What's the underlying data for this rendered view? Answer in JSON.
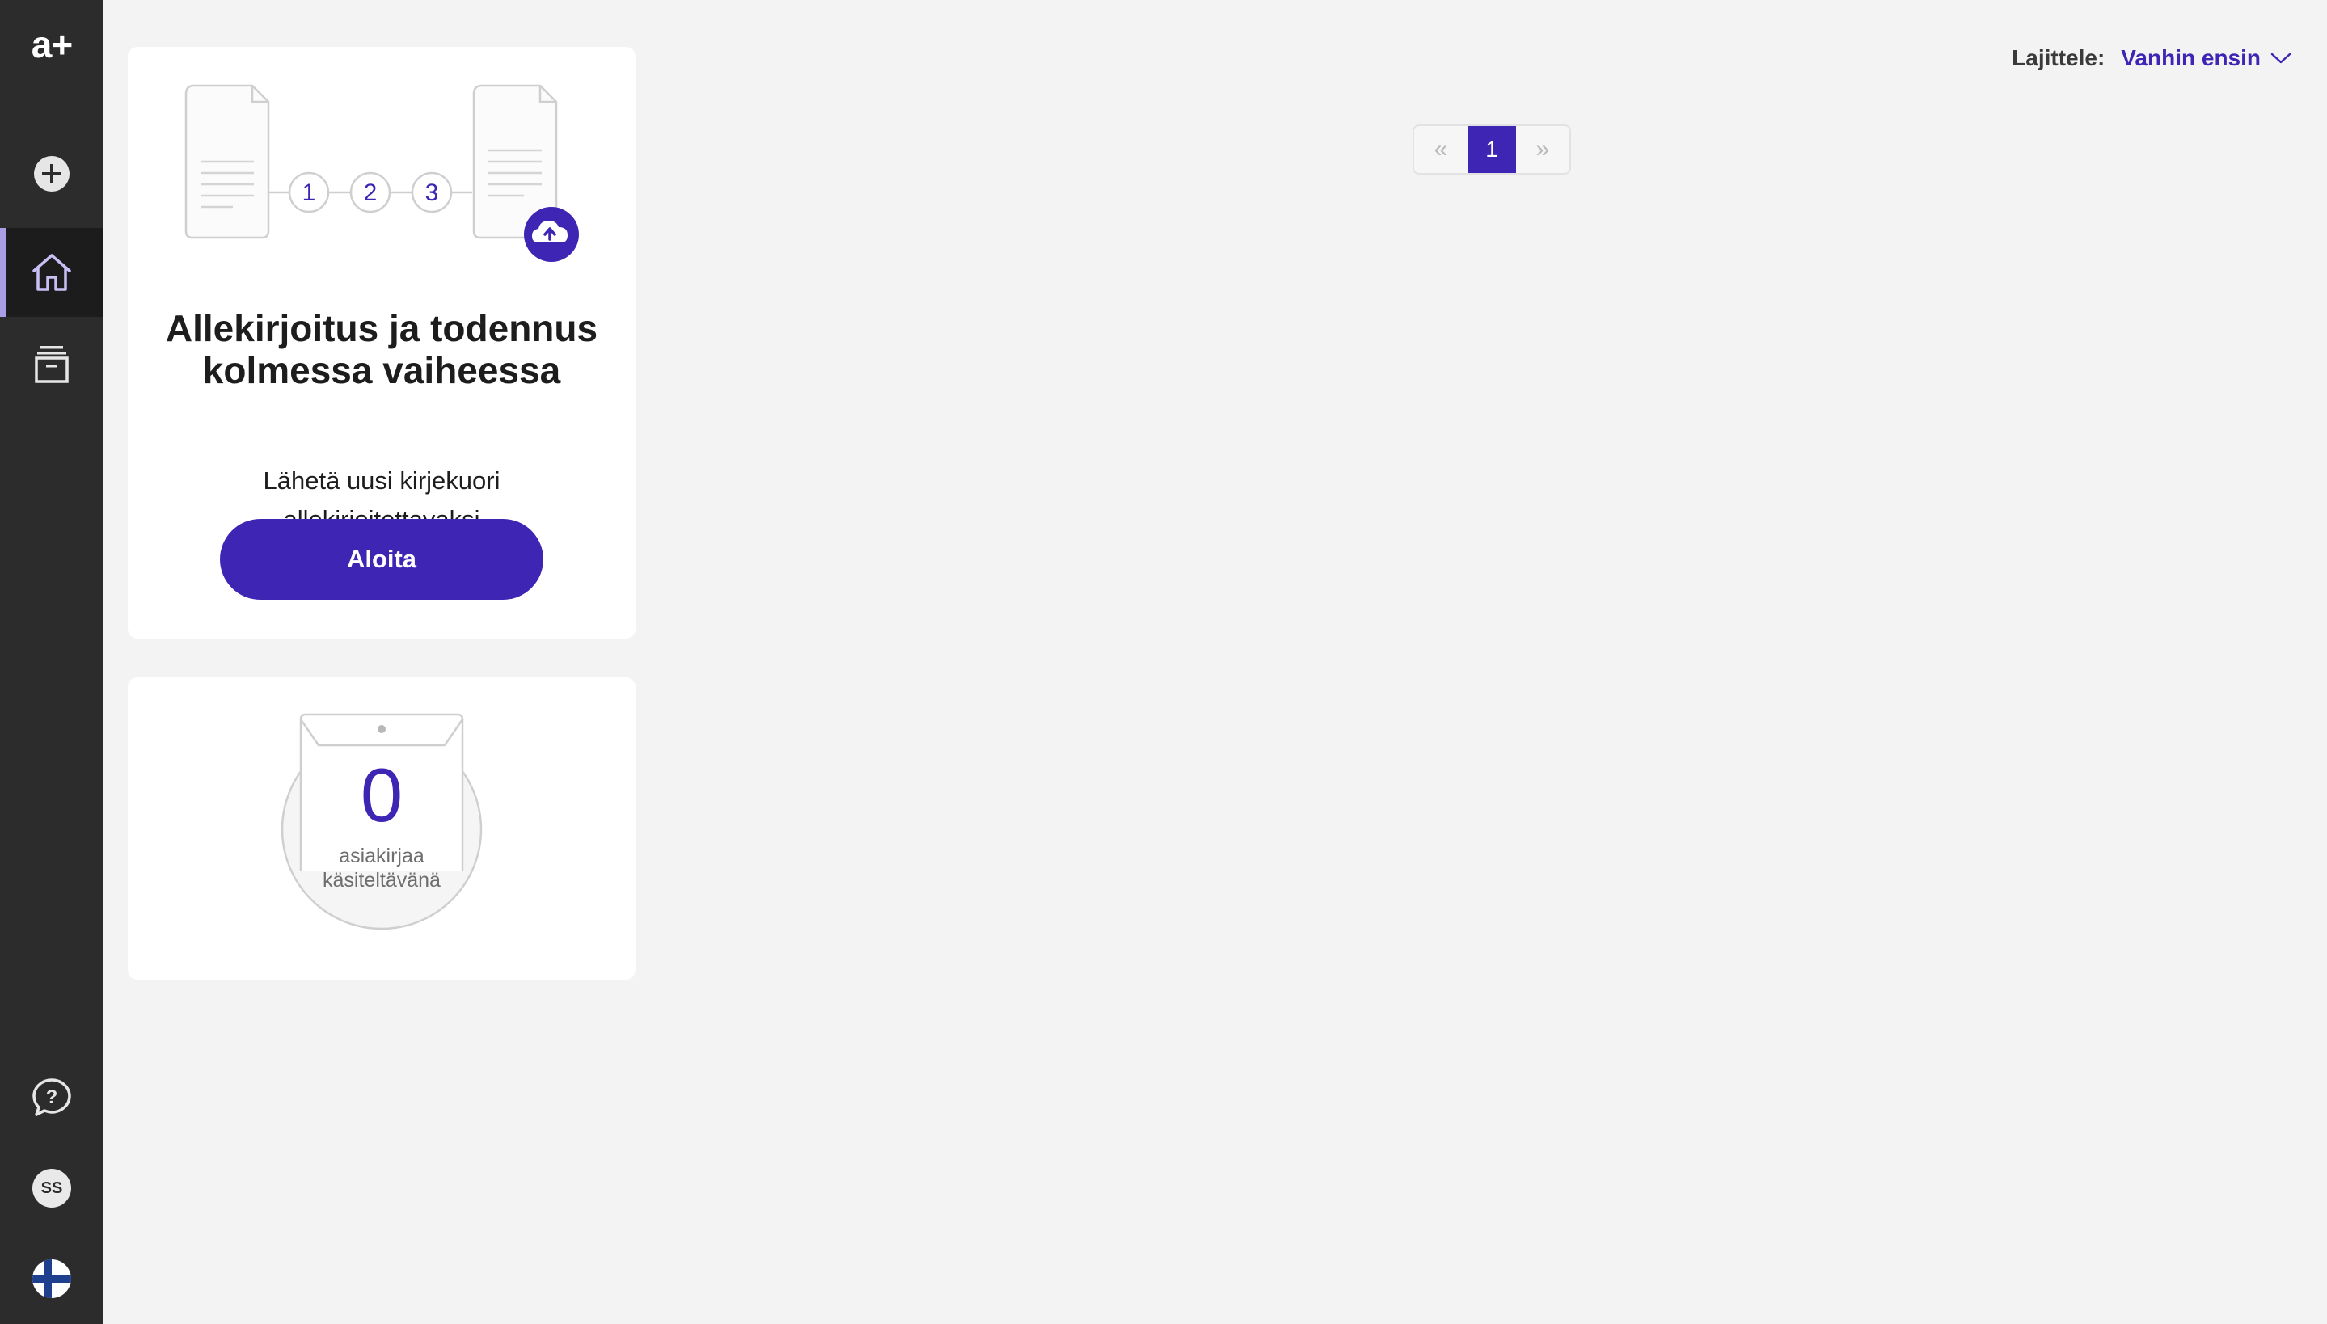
{
  "sidebar": {
    "logo_text": "a+",
    "items": [
      {
        "name": "new-envelope",
        "icon": "plus-circle-icon"
      },
      {
        "name": "home",
        "icon": "home-icon",
        "active": true
      },
      {
        "name": "archive",
        "icon": "archive-icon"
      }
    ],
    "bottom": {
      "help_icon": "help-icon",
      "avatar_initials": "SS",
      "language_icon": "finland-flag-icon"
    }
  },
  "start_card": {
    "step_numbers": [
      "1",
      "2",
      "3"
    ],
    "title": "Allekirjoitus ja todennus kolmessa vaiheessa",
    "subtitle": "Lähetä uusi kirjekuori allekirjoitettavaksi",
    "button_label": "Aloita",
    "upload_icon": "cloud-upload-icon"
  },
  "count_card": {
    "count": "0",
    "label": "asiakirjaa käsiteltävänä"
  },
  "sort": {
    "label": "Lajittele:",
    "value": "Vanhin ensin"
  },
  "pagination": {
    "prev": "«",
    "pages": [
      "1"
    ],
    "current": "1",
    "next": "»"
  },
  "colors": {
    "accent": "#3f25b3",
    "sidebar": "#2c2c2c",
    "sidebar_active": "#1c1c1c",
    "active_indicator": "#a99ee6",
    "background": "#f3f3f3"
  }
}
